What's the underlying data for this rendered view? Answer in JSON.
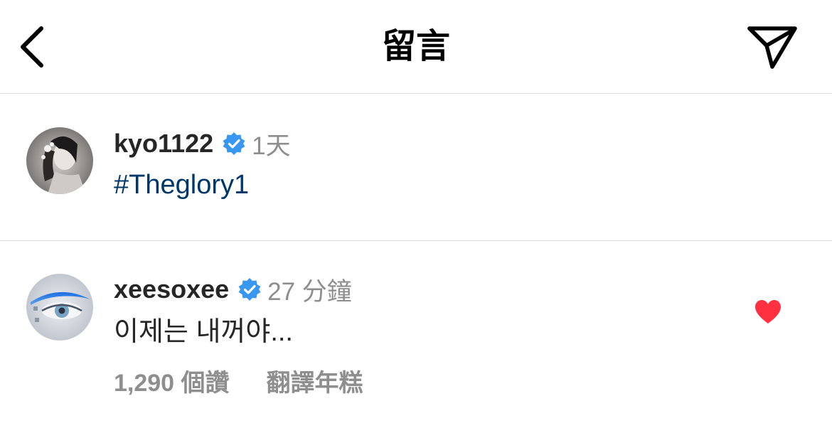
{
  "header": {
    "title": "留言"
  },
  "post": {
    "username": "kyo1122",
    "verified": true,
    "timestamp": "1天",
    "caption": "#Theglory1"
  },
  "comment": {
    "username": "xeesoxee",
    "verified": true,
    "timestamp": "27 分鐘",
    "text": "이제는 내꺼야...",
    "likes_label": "1,290 個讚",
    "translate_label": "翻譯年糕",
    "liked": true
  },
  "colors": {
    "verified_blue": "#3897f0",
    "like_red": "#ff3040",
    "hashtag_blue": "#00376b",
    "secondary_gray": "#8e8e8e",
    "divider": "#dbdbdb"
  },
  "icons": {
    "back": "chevron-left-icon",
    "share": "paper-plane-icon",
    "verified": "verified-badge-icon",
    "like": "heart-filled-icon"
  }
}
